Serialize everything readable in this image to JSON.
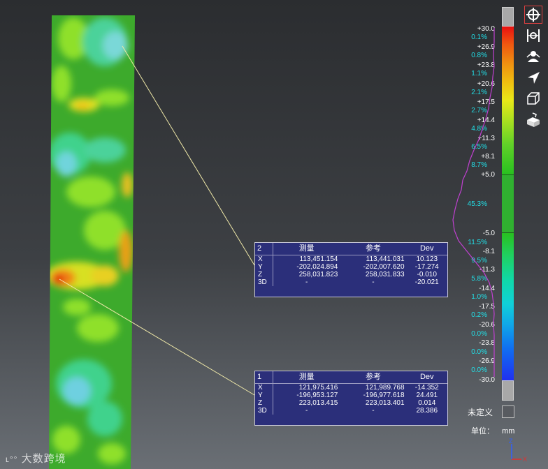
{
  "panels": [
    {
      "id": "2",
      "headers": [
        "测量",
        "参考",
        "Dev"
      ],
      "rows": [
        {
          "axis": "X",
          "measured": "113,451.154",
          "reference": "113,441.031",
          "dev": "10.123"
        },
        {
          "axis": "Y",
          "measured": "-202,024.894",
          "reference": "-202,007.620",
          "dev": "-17.274"
        },
        {
          "axis": "Z",
          "measured": "258,031.823",
          "reference": "258,031.833",
          "dev": "-0.010"
        },
        {
          "axis": "3D",
          "measured": "-",
          "reference": "-",
          "dev": "-20.021"
        }
      ]
    },
    {
      "id": "1",
      "headers": [
        "测量",
        "参考",
        "Dev"
      ],
      "rows": [
        {
          "axis": "X",
          "measured": "121,975.416",
          "reference": "121,989.768",
          "dev": "-14.352"
        },
        {
          "axis": "Y",
          "measured": "-196,953.127",
          "reference": "-196,977.618",
          "dev": "24.491"
        },
        {
          "axis": "Z",
          "measured": "223,013.415",
          "reference": "223,013.401",
          "dev": "0.014"
        },
        {
          "axis": "3D",
          "measured": "-",
          "reference": "-",
          "dev": "28.386"
        }
      ]
    }
  ],
  "scale": {
    "values": [
      "+30.0",
      "+26.9",
      "+23.8",
      "+20.6",
      "+17.5",
      "+14.4",
      "+11.3",
      "+8.1",
      "+5.0",
      "-5.0",
      "-8.1",
      "-11.3",
      "-14.4",
      "-17.5",
      "-20.6",
      "-23.8",
      "-26.9",
      "-30.0"
    ],
    "percents": [
      "0.1%",
      "0.8%",
      "1.1%",
      "2.1%",
      "2.7%",
      "4.8%",
      "6.5%",
      "8.7%",
      "45.3%",
      "11.5%",
      "9.5%",
      "5.8%",
      "1.0%",
      "0.2%",
      "0.0%",
      "0.0%",
      "0.0%"
    ],
    "over_color": "#a8a8a8",
    "under_color": "#a8a8a8",
    "histogram_color": "#c040d0"
  },
  "undefined_label": "未定义",
  "unit_label": "单位：",
  "unit_value": "mm",
  "watermark": "大数跨境",
  "axes": {
    "z": "Z",
    "x": "X"
  },
  "tools": [
    "crosshair-icon",
    "plane-point-icon",
    "person-icon",
    "arrow-icon",
    "cube-icon",
    "box-hand-icon"
  ]
}
